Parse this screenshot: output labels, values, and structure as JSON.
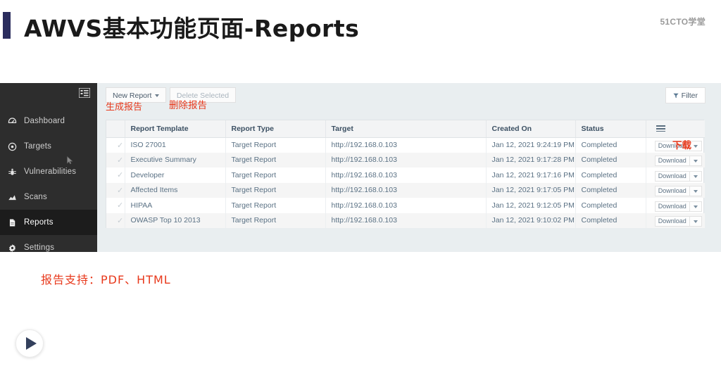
{
  "slide": {
    "title": "AWVS基本功能页面-Reports",
    "watermark": "51CTO学堂"
  },
  "sidebar": {
    "toggle_icon": "collapse-menu-icon",
    "items": [
      {
        "label": "Dashboard",
        "icon": "dashboard-icon",
        "active": false
      },
      {
        "label": "Targets",
        "icon": "target-icon",
        "active": false
      },
      {
        "label": "Vulnerabilities",
        "icon": "bug-icon",
        "active": false
      },
      {
        "label": "Scans",
        "icon": "chart-icon",
        "active": false
      },
      {
        "label": "Reports",
        "icon": "document-icon",
        "active": true
      },
      {
        "label": "Settings",
        "icon": "gear-icon",
        "active": false
      }
    ]
  },
  "toolbar": {
    "new_report_label": "New Report",
    "delete_selected_label": "Delete Selected",
    "filter_label": "Filter",
    "filter_icon": "funnel-icon"
  },
  "annotations": {
    "new_report": "生成报告",
    "delete_selected": "删除报告",
    "download": "下载",
    "bottom_note": "报告支持：PDF、HTML"
  },
  "table": {
    "menu_icon": "hamburger-menu-icon",
    "check_glyph": "✓",
    "columns": [
      "Report Template",
      "Report Type",
      "Target",
      "Created On",
      "Status"
    ],
    "download_label": "Download",
    "rows": [
      {
        "template": "ISO 27001",
        "type": "Target Report",
        "target": "http://192.168.0.103",
        "created": "Jan 12, 2021 9:24:19 PM",
        "status": "Completed"
      },
      {
        "template": "Executive Summary",
        "type": "Target Report",
        "target": "http://192.168.0.103",
        "created": "Jan 12, 2021 9:17:28 PM",
        "status": "Completed"
      },
      {
        "template": "Developer",
        "type": "Target Report",
        "target": "http://192.168.0.103",
        "created": "Jan 12, 2021 9:17:16 PM",
        "status": "Completed"
      },
      {
        "template": "Affected Items",
        "type": "Target Report",
        "target": "http://192.168.0.103",
        "created": "Jan 12, 2021 9:17:05 PM",
        "status": "Completed"
      },
      {
        "template": "HIPAA",
        "type": "Target Report",
        "target": "http://192.168.0.103",
        "created": "Jan 12, 2021 9:12:05 PM",
        "status": "Completed"
      },
      {
        "template": "OWASP Top 10 2013",
        "type": "Target Report",
        "target": "http://192.168.0.103",
        "created": "Jan 12, 2021 9:10:02 PM",
        "status": "Completed"
      }
    ]
  },
  "player": {
    "play_icon": "play-icon"
  },
  "colors": {
    "accent": "#2b2d5e",
    "annotation": "#e8391c",
    "sidebar": "#2d2d2d",
    "panel": "#e9eef0"
  }
}
